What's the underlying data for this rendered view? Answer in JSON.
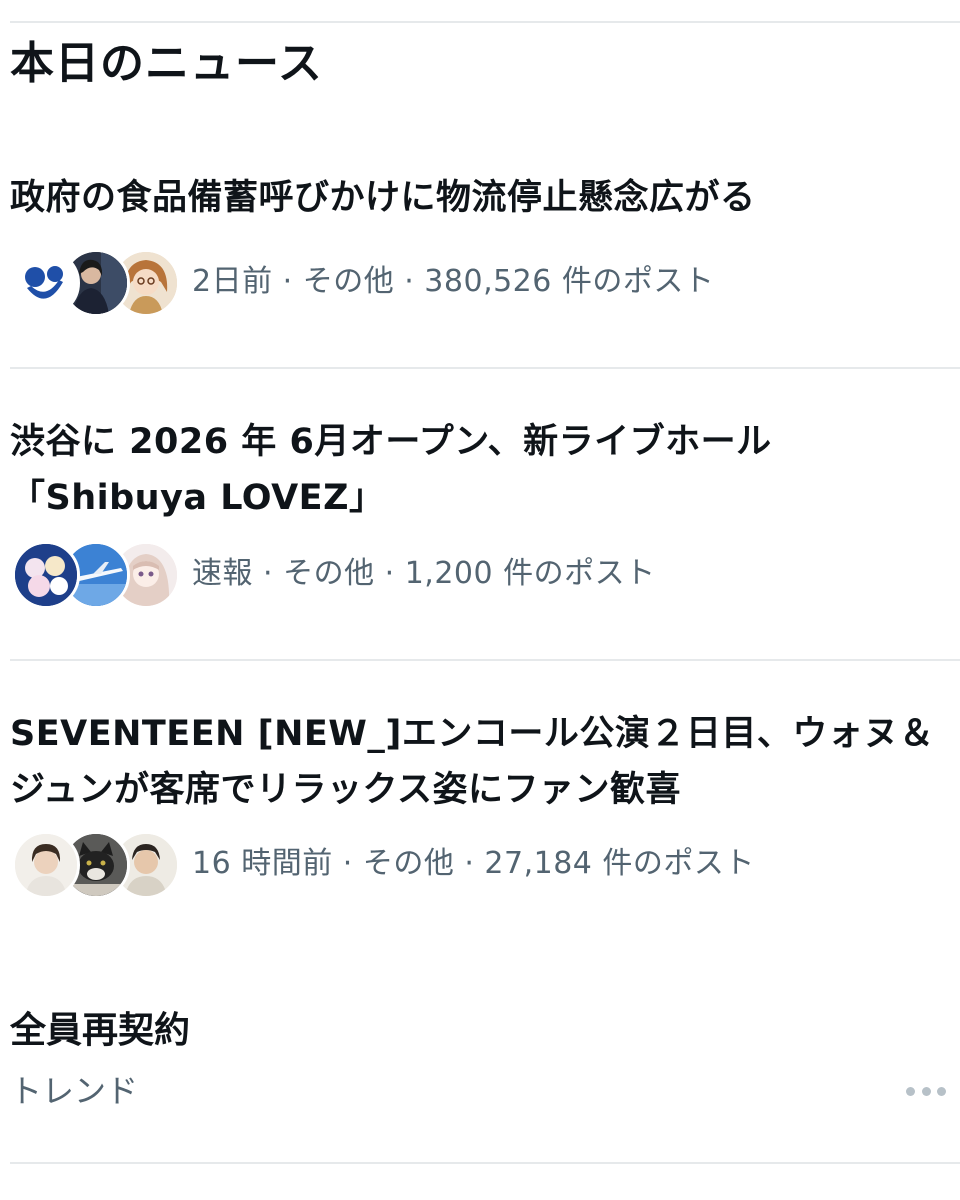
{
  "section": {
    "title": "本日のニュース"
  },
  "news": [
    {
      "headline": "政府の食品備蓄呼びかけに物流停止懸念広がる",
      "meta": "2日前 · その他 · 380,526 件のポスト",
      "avatars": [
        "organization-logo-avatar",
        "person-photo-avatar",
        "anime-character-avatar"
      ]
    },
    {
      "headline": "渋谷に 2026 年 6月オープン、新ライブホール「Shibuya LOVEZ」",
      "meta": "速報 · その他 · 1,200 件のポスト",
      "avatars": [
        "sweets-photo-avatar",
        "airplane-sky-avatar",
        "illustration-girl-avatar"
      ]
    },
    {
      "headline": "SEVENTEEN [NEW_]エンコール公演２日目、ウォヌ＆ジュンが客席でリラックス姿にファン歓喜",
      "meta": "16 時間前 · その他 · 27,184 件のポスト",
      "avatars": [
        "person-photo-avatar",
        "cat-photo-avatar",
        "person-photo-avatar"
      ]
    }
  ],
  "trend": {
    "name": "全員再契約",
    "category": "トレンド",
    "more_icon": "more-horizontal-icon"
  },
  "colors": {
    "text_primary": "#0f1419",
    "text_secondary": "#536471",
    "divider": "#e6e9eb"
  }
}
